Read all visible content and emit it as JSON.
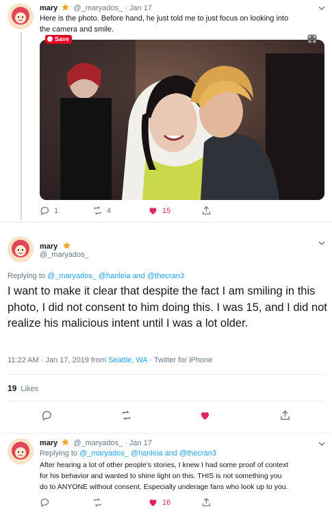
{
  "colors": {
    "accent": "#1da1f2",
    "like": "#e0245e",
    "muted": "#657786",
    "pinterest": "#e60023"
  },
  "tweet1": {
    "name": "mary",
    "handle": "@_maryados_",
    "date": "Jan 17",
    "text_line1": "Here is the photo. Before hand, he just told me to just focus on looking into",
    "text_line2": "the camera and smile.",
    "save_label": "Save",
    "replies": "1",
    "retweets": "4",
    "likes": "15"
  },
  "tweet2": {
    "name": "mary",
    "handle": "@_maryados_",
    "replying_prefix": "Replying to",
    "replying_users": "@_maryados_ @hanleia and @thecran3",
    "text": "I want to make it clear that despite the fact I am smiling in this photo, I did not consent to him doing this. I was 15, and I did not realize his malicious intent until I was a lot older.",
    "time": "11:22 AM · Jan 17, 2019 from",
    "location": "Seattle, WA",
    "source": "· Twitter for iPhone",
    "likes_count": "19",
    "likes_label": "Likes"
  },
  "tweet3": {
    "name": "mary",
    "handle": "@_maryados_",
    "date": "Jan 17",
    "replying_prefix": "Replying to",
    "replying_users": "@_maryados_ @hanleia and @thecran3",
    "text_line1": "After hearing a lot of other people's stories, I knew I had some proof of context",
    "text_line2": "for his behavior and wanted to shine light on this. THIS is not something you",
    "text_line3": "do to ANYONE without consent. Especially underage fans who look up to you.",
    "likes": "16"
  },
  "icons": [
    "star-icon",
    "chevron-down-icon",
    "reply-icon",
    "retweet-icon",
    "heart-icon",
    "share-icon",
    "expand-icon",
    "pin-icon"
  ]
}
